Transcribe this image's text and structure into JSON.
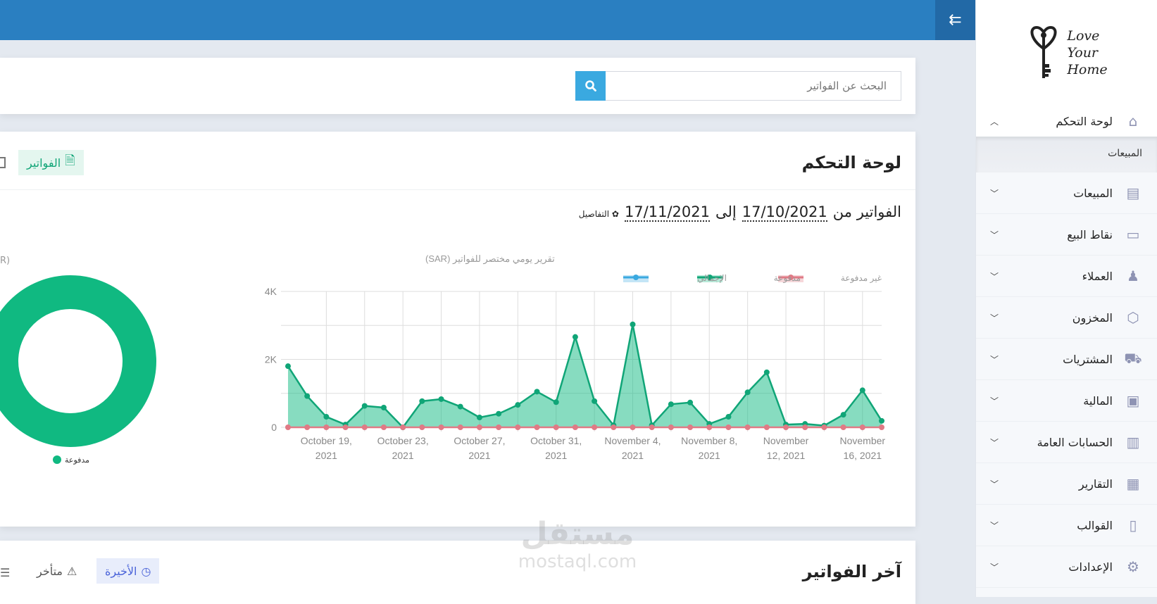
{
  "header": {
    "toggle_icon": "menu-collapse-icon"
  },
  "sidebar": {
    "logo": {
      "line1": "Love",
      "line2": "Your",
      "line3": "Home"
    },
    "dashboard": {
      "label": "لوحة التحكم",
      "icon": "home-icon"
    },
    "submenu": {
      "label": "المبيعات"
    },
    "items": [
      {
        "label": "المبيعات",
        "icon": "sales-icon"
      },
      {
        "label": "نقاط البيع",
        "icon": "pos-icon"
      },
      {
        "label": "العملاء",
        "icon": "customers-icon"
      },
      {
        "label": "المخزون",
        "icon": "inventory-icon"
      },
      {
        "label": "المشتريات",
        "icon": "truck-icon"
      },
      {
        "label": "المالية",
        "icon": "safe-icon"
      },
      {
        "label": "الحسابات العامة",
        "icon": "money-icon"
      },
      {
        "label": "التقارير",
        "icon": "chart-icon"
      },
      {
        "label": "القوالب",
        "icon": "file-icon"
      },
      {
        "label": "الإعدادات",
        "icon": "gear-icon"
      }
    ]
  },
  "search": {
    "placeholder": "البحث عن الفواتير"
  },
  "dashboard": {
    "title": "لوحة التحكم",
    "invoices_tab": "الفواتير",
    "range_prefix": "الفواتير من",
    "date_from": "17/10/2021",
    "range_to": "إلى",
    "date_to": "17/11/2021",
    "details_link": "التفاصيل",
    "donut_title_fragment": "R)",
    "donut_legend": "مدفوعة"
  },
  "latest": {
    "title": "آخر الفواتير",
    "tab_recent": "الأخيرة",
    "tab_overdue": "متأخر"
  },
  "watermark": {
    "ar": "مستقل",
    "en": "mostaql.com"
  },
  "colors": {
    "paid": "#10b981",
    "unpaid": "#e07a85",
    "total": "#3aa9e0",
    "header": "#2a7fc1"
  },
  "chart_data": {
    "type": "line",
    "title": "تقرير يومي مختصر للفواتير (SAR)",
    "ylim": [
      0,
      4000
    ],
    "yticks": [
      "0",
      "2K",
      "4K"
    ],
    "x": [
      "Oct 17",
      "Oct 18",
      "Oct 19",
      "Oct 20",
      "Oct 21",
      "Oct 22",
      "Oct 23",
      "Oct 24",
      "Oct 25",
      "Oct 26",
      "Oct 27",
      "Oct 28",
      "Oct 29",
      "Oct 30",
      "Oct 31",
      "Nov 1",
      "Nov 2",
      "Nov 3",
      "Nov 4",
      "Nov 5",
      "Nov 6",
      "Nov 7",
      "Nov 8",
      "Nov 9",
      "Nov 10",
      "Nov 11",
      "Nov 12",
      "Nov 13",
      "Nov 14",
      "Nov 15",
      "Nov 16",
      "Nov 17"
    ],
    "xtick_labels": [
      {
        "index": 2,
        "l1": "October 19,",
        "l2": "2021"
      },
      {
        "index": 6,
        "l1": "October 23,",
        "l2": "2021"
      },
      {
        "index": 10,
        "l1": "October 27,",
        "l2": "2021"
      },
      {
        "index": 14,
        "l1": "October 31,",
        "l2": "2021"
      },
      {
        "index": 18,
        "l1": "November 4,",
        "l2": "2021"
      },
      {
        "index": 22,
        "l1": "November 8,",
        "l2": "2021"
      },
      {
        "index": 26,
        "l1": "November",
        "l2": "12, 2021"
      },
      {
        "index": 30,
        "l1": "November",
        "l2": "16, 2021"
      }
    ],
    "legend": [
      "الإجمالي",
      "مدفوعة",
      "غير مدفوعة"
    ],
    "series": [
      {
        "name": "مدفوعة",
        "values": [
          1800,
          920,
          310,
          80,
          630,
          580,
          0,
          770,
          830,
          610,
          290,
          400,
          660,
          1050,
          740,
          2660,
          770,
          60,
          3030,
          60,
          680,
          730,
          100,
          310,
          1030,
          1620,
          80,
          100,
          50,
          370,
          1090,
          190
        ]
      },
      {
        "name": "غير مدفوعة",
        "values": [
          0,
          0,
          0,
          0,
          0,
          0,
          0,
          0,
          0,
          0,
          0,
          0,
          0,
          0,
          0,
          0,
          0,
          0,
          0,
          0,
          0,
          0,
          0,
          0,
          0,
          0,
          0,
          0,
          0,
          0,
          0,
          0
        ]
      }
    ],
    "donut": {
      "type": "pie",
      "slices": [
        {
          "name": "مدفوعة",
          "value": 100
        }
      ]
    }
  }
}
